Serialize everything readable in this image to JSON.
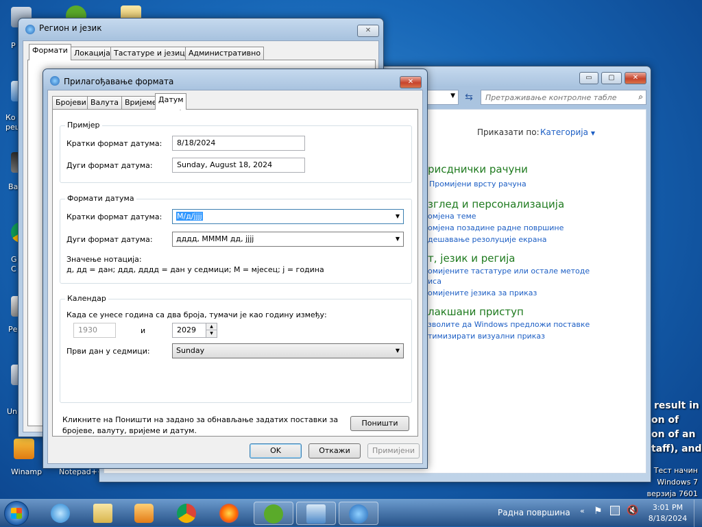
{
  "desktop": {
    "icons": [
      {
        "label": "Р"
      },
      {
        "label": "Ко реш"
      },
      {
        "label": "Ва"
      },
      {
        "label": "G C"
      },
      {
        "label": "Ре"
      },
      {
        "label": "Un"
      },
      {
        "label": "Winamp"
      },
      {
        "label": "Notepad++"
      }
    ],
    "message_lines": [
      "result in",
      "on of",
      "on of an",
      "taff), and"
    ],
    "watermark": [
      "Тест начин",
      "Windows 7",
      "верзија 7601"
    ]
  },
  "region_window": {
    "title": "Регион и језик",
    "tabs": [
      "Формати",
      "Локација",
      "Тастатуре и језици",
      "Административно"
    ]
  },
  "control_panel": {
    "search_placeholder": "Претраживање контролне табле",
    "view_by_label": "Приказати по:",
    "view_by_value": "Категорија",
    "sections": [
      {
        "heading": "рисднички рачуни",
        "links": [
          "Промијени врсту рачуна"
        ]
      },
      {
        "heading": "зглед и персонализација",
        "links": [
          "омјена теме",
          "омјена позадине радне површине",
          "дешавање резолуције екрана"
        ]
      },
      {
        "heading": "т, језик и регија",
        "links": [
          "омијените тастатуре или остале методе",
          "иса",
          "омијените језика за приказ"
        ]
      },
      {
        "heading": "лакшани приступ",
        "links": [
          "зволите да Windows предложи поставке",
          "тимизирати визуални приказ"
        ]
      }
    ]
  },
  "customize_dialog": {
    "title": "Прилагођавање формата",
    "tabs": [
      "Бројеви",
      "Валута",
      "Вријеме",
      "Датум"
    ],
    "example_group": {
      "label": "Примјер",
      "short_label": "Кратки формат датума:",
      "short_value": "8/18/2024",
      "long_label": "Дуги формат датума:",
      "long_value": "Sunday, August 18, 2024"
    },
    "formats_group": {
      "label": "Формати датума",
      "short_label": "Кратки формат датума:",
      "short_value": "М/д/јјјј",
      "long_label": "Дуги формат датума:",
      "long_value": "дддд, ММММ дд, јјјј",
      "notation_title": "Значење нотација:",
      "notation_text": "д, дд = дан;  ддд, дддд = дан у седмици;  М = мјесец;  ј = година"
    },
    "calendar_group": {
      "label": "Календар",
      "two_digit_text": "Када се унесе година са два броја, тумачи је као годину између:",
      "year_from": "1930",
      "and_label": "и",
      "year_to": "2029",
      "first_day_label": "Први дан у седмици:",
      "first_day_value": "Sunday"
    },
    "reset_text_1": "Кликните на Поништи на задано за обнављање задатих поставки за",
    "reset_text_2": "бројеве, валуту, вријеме и датум.",
    "reset_button": "Поништи",
    "ok_button": "OK",
    "cancel_button": "Откажи",
    "apply_button": "Примијени"
  },
  "taskbar": {
    "desktop_label": "Радна површина",
    "time": "3:01 PM",
    "date": "8/18/2024"
  }
}
